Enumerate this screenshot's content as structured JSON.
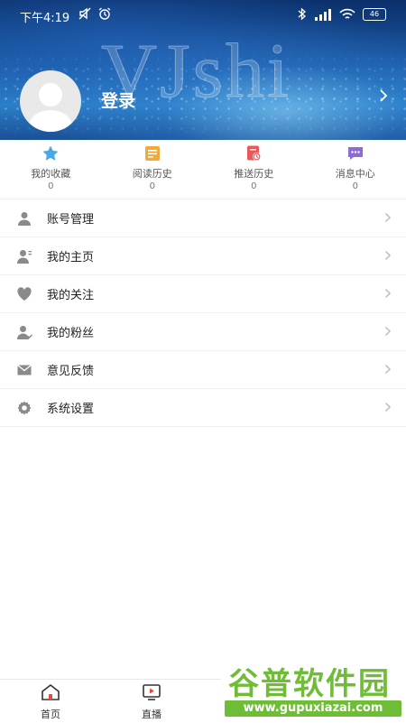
{
  "status_bar": {
    "time": "下午4:19",
    "battery": "46"
  },
  "header": {
    "watermark_text": "VJshi",
    "login_label": "登录"
  },
  "quick_actions": [
    {
      "label": "我的收藏",
      "count": "0",
      "icon": "star-icon",
      "color": "#4aa7e8"
    },
    {
      "label": "阅读历史",
      "count": "0",
      "icon": "note-icon",
      "color": "#f2a93b"
    },
    {
      "label": "推送历史",
      "count": "0",
      "icon": "push-history-icon",
      "color": "#e85a5a"
    },
    {
      "label": "消息中心",
      "count": "0",
      "icon": "message-icon",
      "color": "#8c6ad8"
    }
  ],
  "menu": [
    {
      "label": "账号管理",
      "icon": "user-icon"
    },
    {
      "label": "我的主页",
      "icon": "profile-page-icon"
    },
    {
      "label": "我的关注",
      "icon": "heart-icon"
    },
    {
      "label": "我的粉丝",
      "icon": "fans-icon"
    },
    {
      "label": "意见反馈",
      "icon": "mail-icon"
    },
    {
      "label": "系统设置",
      "icon": "gear-icon"
    }
  ],
  "bottom_nav": [
    {
      "label": "首页",
      "icon": "home-icon"
    },
    {
      "label": "直播",
      "icon": "tv-icon"
    }
  ],
  "site_badge": {
    "title": "谷普软件园",
    "url": "www.gupuxiazai.com"
  },
  "colors": {
    "icon_gray": "#8a8a8a",
    "chevron_gray": "#bdbdbd",
    "brand_green": "#6fbd36"
  }
}
